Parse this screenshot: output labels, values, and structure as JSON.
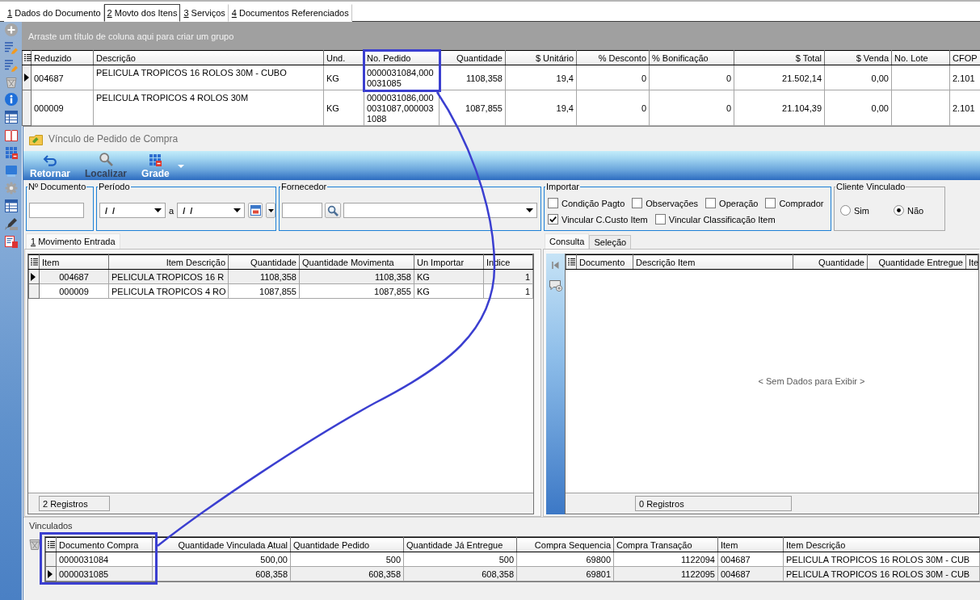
{
  "document_tabs": [
    {
      "label": "1 Dados do Documento",
      "selected": false
    },
    {
      "label": "2 Movto dos Itens",
      "selected": true
    },
    {
      "label": "3 Serviços",
      "selected": false
    },
    {
      "label": "4 Documentos Referenciados",
      "selected": false
    }
  ],
  "items_grid": {
    "group_hint": "Arraste um título de coluna aqui para criar um grupo",
    "columns": [
      "Reduzido",
      "Descrição",
      "Und.",
      "No. Pedido",
      "Quantidade",
      "$ Unitário",
      "% Desconto",
      "% Bonificação",
      "$ Total",
      "$ Venda",
      "No. Lote",
      "CFOP"
    ],
    "rows": [
      {
        "selected": true,
        "reduzido": "004687",
        "descricao": "PELICULA TROPICOS 16 ROLOS 30M - CUBO",
        "und": "KG",
        "no_pedido": "0000031084,0000031085",
        "quantidade": "1108,358",
        "unitario": "19,4",
        "desconto": "0",
        "bonificacao": "0",
        "total": "21.502,14",
        "venda": "0,00",
        "cfop": "2.101"
      },
      {
        "selected": false,
        "reduzido": "000009",
        "descricao": "PELICULA TROPICOS 4 ROLOS 30M",
        "und": "KG",
        "no_pedido": "0000031086,0000031087,0000031088",
        "quantidade": "1087,855",
        "unitario": "19,4",
        "desconto": "0",
        "bonificacao": "0",
        "total": "21.104,39",
        "venda": "0,00",
        "cfop": "2.101"
      }
    ]
  },
  "dialog": {
    "title": "Vínculo de Pedido de Compra",
    "toolbar": [
      {
        "label": "Retornar",
        "kind": "button",
        "disabled": false
      },
      {
        "label": "Localizar",
        "kind": "button",
        "disabled": true
      },
      {
        "label": "Grade",
        "kind": "menu",
        "disabled": false
      }
    ],
    "filters": {
      "documento": {
        "label": "Nº Documento"
      },
      "periodo": {
        "label": "Período",
        "from": "/ /",
        "separator": "a",
        "to": "/ /"
      },
      "fornecedor": {
        "label": "Fornecedor"
      },
      "importar": {
        "label": "Importar",
        "options": [
          {
            "label": "Condição Pagto",
            "checked": false
          },
          {
            "label": "Observações",
            "checked": false
          },
          {
            "label": "Operação",
            "checked": false
          },
          {
            "label": "Comprador",
            "checked": false
          },
          {
            "label": "Vincular C.Custo Item",
            "checked": true
          },
          {
            "label": "Vincular Classificação Item",
            "checked": false
          }
        ]
      },
      "cliente_vinculado": {
        "label": "Cliente Vinculado",
        "options": [
          {
            "label": "Sim",
            "selected": false
          },
          {
            "label": "Não",
            "selected": true
          }
        ]
      }
    },
    "movimento_entrada": {
      "tabs": [
        {
          "label": "1 Movimento Entrada",
          "selected": true
        }
      ],
      "columns": [
        "Item",
        "Item Descrição",
        "Quantidade",
        "Quantidade Movimenta",
        "Un Importar",
        "Indice"
      ],
      "rows": [
        {
          "selected": true,
          "cells": [
            "004687",
            "PELICULA TROPICOS 16 R",
            "1108,358",
            "1108,358",
            "KG",
            "1"
          ]
        },
        {
          "selected": false,
          "cells": [
            "000009",
            "PELICULA TROPICOS 4 RO",
            "1087,855",
            "1087,855",
            "KG",
            "1"
          ]
        }
      ],
      "footer": "2 Registros"
    },
    "consulta": {
      "tabs": [
        {
          "label": "Consulta",
          "selected": true
        },
        {
          "label": "Seleção",
          "selected": false
        }
      ],
      "columns": [
        "Documento",
        "Descrição Item",
        "Quantidade",
        "Quantidade Entregue",
        "Ite"
      ],
      "empty_message": "< Sem Dados para Exibir >",
      "footer": "0 Registros"
    },
    "vinculados": {
      "label": "Vinculados",
      "columns": [
        "Documento Compra",
        "Quantidade Vinculada Atual",
        "Quantidade Pedido",
        "Quantidade Já Entregue",
        "Compra Sequencia",
        "Compra Transação",
        "Item",
        "Item Descrição"
      ],
      "rows": [
        {
          "selected": false,
          "cells": [
            "0000031084",
            "500,00",
            "500",
            "500",
            "69800",
            "1122094",
            "004687",
            "PELICULA TROPICOS 16 ROLOS 30M - CUB"
          ]
        },
        {
          "selected": true,
          "cells": [
            "0000031085",
            "608,358",
            "608,358",
            "608,358",
            "69801",
            "1122095",
            "004687",
            "PELICULA TROPICOS 16 ROLOS 30M - CUB"
          ]
        }
      ]
    }
  }
}
